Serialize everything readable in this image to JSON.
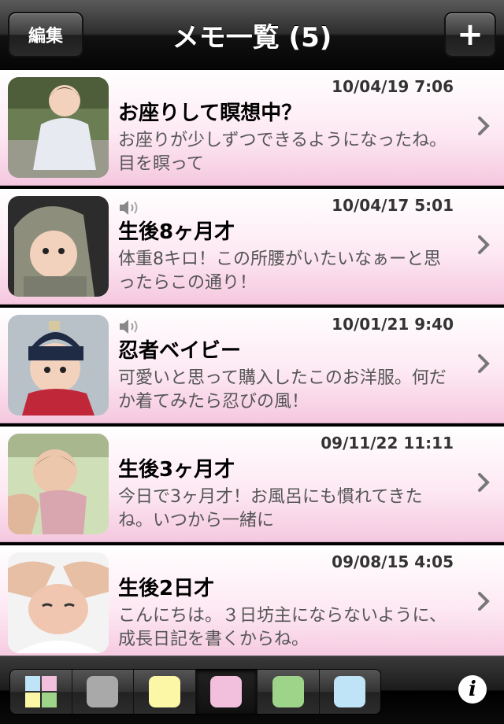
{
  "nav": {
    "edit_label": "編集",
    "title": "メモ一覧 (5)",
    "add_label": "+"
  },
  "memos": [
    {
      "date": "10/04/19 7:06",
      "title": "お座りして瞑想中？",
      "body": "お座りが少しずつできるようになったね。目を瞑って",
      "has_audio": false
    },
    {
      "date": "10/04/17 5:01",
      "title": "生後8ヶ月才",
      "body": "体重8キロ！この所腰がいたいなぁーと思ったらこの通り！",
      "has_audio": true
    },
    {
      "date": "10/01/21 9:40",
      "title": "忍者ベイビー",
      "body": "可愛いと思って購入したこのお洋服。何だか着てみたら忍びの風！",
      "has_audio": true
    },
    {
      "date": "09/11/22 11:11",
      "title": "生後3ヶ月才",
      "body": "今日で3ヶ月才！お風呂にも慣れてきたね。いつから一緒に",
      "has_audio": false
    },
    {
      "date": "09/08/15 4:05",
      "title": "生後2日才",
      "body": "こんにちは。３日坊主にならないように、成長日記を書くからね。",
      "has_audio": false
    }
  ],
  "toolbar": {
    "filters": [
      {
        "name": "all",
        "color": "grid"
      },
      {
        "name": "gray",
        "color": "#a9a9a9"
      },
      {
        "name": "yellow",
        "color": "#fbf7a6"
      },
      {
        "name": "pink",
        "color": "#f2c0dc"
      },
      {
        "name": "green",
        "color": "#9ed38a"
      },
      {
        "name": "blue",
        "color": "#bfe3f7"
      }
    ],
    "selected_filter": "pink",
    "info_label": "i"
  }
}
